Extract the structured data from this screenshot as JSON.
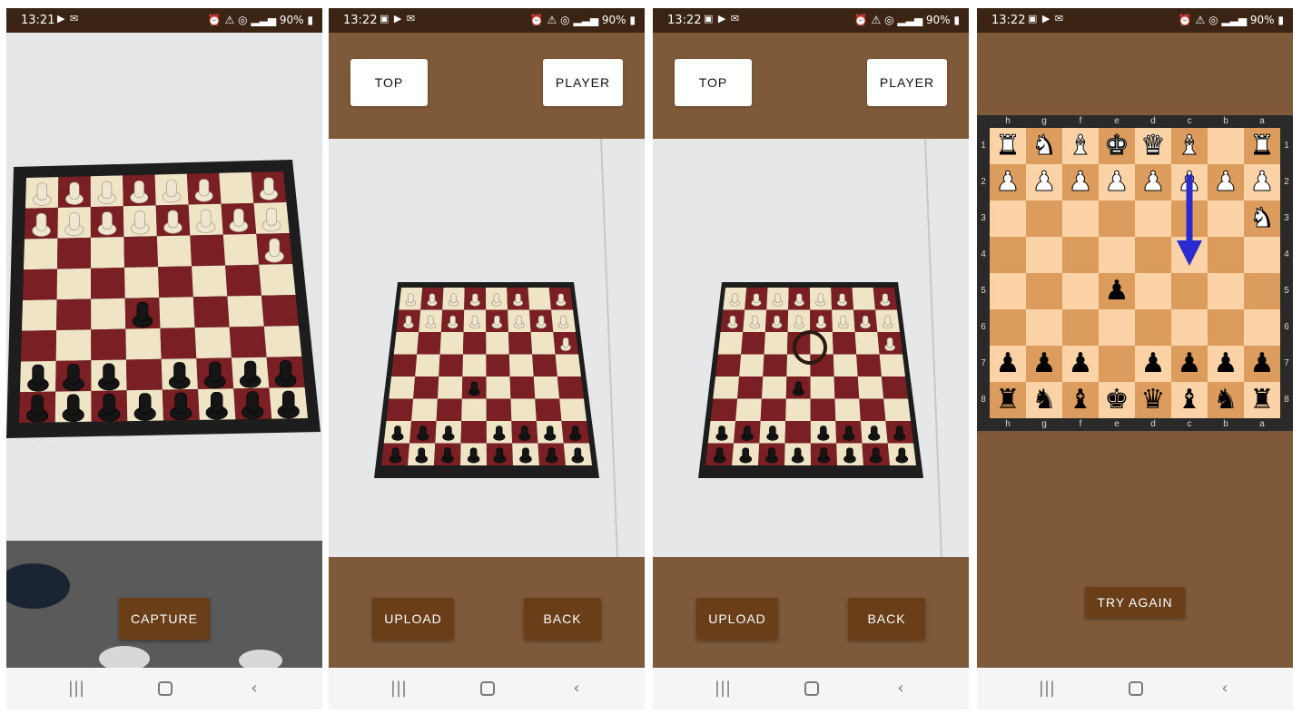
{
  "statusbar": {
    "screen1": {
      "time": "13:21",
      "battery": "90%"
    },
    "screen2": {
      "time": "13:22",
      "battery": "90%"
    },
    "screen3": {
      "time": "13:22",
      "battery": "90%"
    },
    "screen4": {
      "time": "13:22",
      "battery": "90%"
    }
  },
  "screen1": {
    "capture_label": "CAPTURE"
  },
  "screen2": {
    "top_label": "TOP",
    "player_label": "PLAYER",
    "upload_label": "UPLOAD",
    "back_label": "BACK"
  },
  "screen3": {
    "top_label": "TOP",
    "player_label": "PLAYER",
    "upload_label": "UPLOAD",
    "back_label": "BACK"
  },
  "screen4": {
    "try_again_label": "TRY AGAIN",
    "files": [
      "h",
      "g",
      "f",
      "e",
      "d",
      "c",
      "b",
      "a"
    ],
    "ranks": [
      "1",
      "2",
      "3",
      "4",
      "5",
      "6",
      "7",
      "8"
    ],
    "position": [
      [
        "wR",
        "wN",
        "wB",
        "wK",
        "wQ",
        "wB",
        "",
        "wR"
      ],
      [
        "wP",
        "wP",
        "wP",
        "wP",
        "wP",
        "wP",
        "wP",
        "wP"
      ],
      [
        "",
        "",
        "",
        "",
        "",
        "",
        "",
        "wN"
      ],
      [
        "",
        "",
        "",
        "",
        "",
        "",
        "",
        ""
      ],
      [
        "",
        "",
        "",
        "bP",
        "",
        "",
        "",
        ""
      ],
      [
        "",
        "",
        "",
        "",
        "",
        "",
        "",
        ""
      ],
      [
        "bP",
        "bP",
        "bP",
        "",
        "bP",
        "bP",
        "bP",
        "bP"
      ],
      [
        "bR",
        "bN",
        "bB",
        "bK",
        "bQ",
        "bB",
        "bN",
        "bR"
      ]
    ],
    "suggested_move": {
      "from": "c2",
      "to": "c4"
    },
    "colors": {
      "light": "#fbd3a6",
      "dark": "#dc9c5d",
      "arrow": "#2a2ad0",
      "frame": "#2a2a2a",
      "panel": "#7f5a3a"
    }
  },
  "navbar": {
    "recents_icon": "recents-icon",
    "home_icon": "home-icon",
    "back_icon": "back-icon"
  }
}
